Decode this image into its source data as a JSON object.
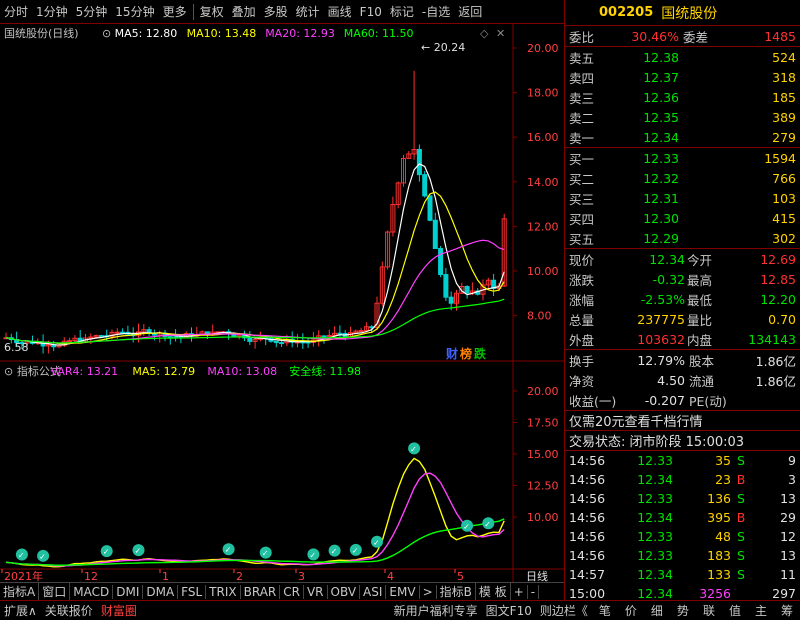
{
  "toolbar": {
    "items": [
      "分时",
      "1分钟",
      "5分钟",
      "15分钟",
      "更多",
      "复权",
      "叠加",
      "多股",
      "统计",
      "画线",
      "F10",
      "标记",
      "-自选",
      "返回"
    ]
  },
  "stock": {
    "code": "002205",
    "name": "国统股份"
  },
  "main_chart": {
    "title": "国统股份(日线)",
    "ma5": "MA5: 12.80",
    "ma10": "MA10: 13.48",
    "ma20": "MA20: 12.93",
    "ma60": "MA60: 11.50",
    "high_label": "20.24",
    "low_label": "6.58",
    "yticks": [
      "20.00",
      "18.00",
      "16.00",
      "14.00",
      "12.00",
      "10.00",
      "8.00"
    ],
    "badges": [
      "财",
      "榜",
      "跌"
    ]
  },
  "sub_chart": {
    "title": "指标公式",
    "var4": "VAR4: 13.21",
    "ma5": "MA5: 12.79",
    "ma10": "MA10: 13.08",
    "safe": "安全线: 11.98",
    "yticks": [
      "20.00",
      "17.50",
      "15.00",
      "12.50",
      "10.00"
    ]
  },
  "xaxis": {
    "labels": [
      "2021年",
      "12",
      "1",
      "2",
      "3",
      "4",
      "5"
    ],
    "period": "日线"
  },
  "tabs": [
    "指标A",
    "窗口",
    "MACD",
    "DMI",
    "DMA",
    "FSL",
    "TRIX",
    "BRAR",
    "CR",
    "VR",
    "OBV",
    "ASI",
    "EMV",
    ">",
    "指标B",
    "模 板",
    "+",
    "-"
  ],
  "bottom": {
    "items": [
      "扩展∧",
      "关联报价",
      "财富圈",
      "新用户福利专享",
      "图文F10",
      "则边栏《"
    ],
    "icons": [
      "笔",
      "价",
      "细",
      "势",
      "联",
      "值",
      "主",
      "筹"
    ]
  },
  "orderbook": {
    "wb_label": "委比",
    "wb": "30.46%",
    "wc_label": "委差",
    "wc": "1485",
    "asks": [
      {
        "l": "卖五",
        "p": "12.38",
        "v": "524"
      },
      {
        "l": "卖四",
        "p": "12.37",
        "v": "318"
      },
      {
        "l": "卖三",
        "p": "12.36",
        "v": "185"
      },
      {
        "l": "卖二",
        "p": "12.35",
        "v": "389"
      },
      {
        "l": "卖一",
        "p": "12.34",
        "v": "279"
      }
    ],
    "bids": [
      {
        "l": "买一",
        "p": "12.33",
        "v": "1594"
      },
      {
        "l": "买二",
        "p": "12.32",
        "v": "766"
      },
      {
        "l": "买三",
        "p": "12.31",
        "v": "103"
      },
      {
        "l": "买四",
        "p": "12.30",
        "v": "415"
      },
      {
        "l": "买五",
        "p": "12.29",
        "v": "302"
      }
    ]
  },
  "quote": [
    {
      "a": "现价",
      "av": "12.34",
      "ac": "g",
      "b": "今开",
      "bv": "12.69",
      "bc": "r"
    },
    {
      "a": "涨跌",
      "av": "-0.32",
      "ac": "g",
      "b": "最高",
      "bv": "12.85",
      "bc": "r"
    },
    {
      "a": "涨幅",
      "av": "-2.53%",
      "ac": "g",
      "b": "最低",
      "bv": "12.20",
      "bc": "g"
    },
    {
      "a": "总量",
      "av": "237775",
      "ac": "y",
      "b": "量比",
      "bv": "0.70",
      "bc": "y"
    },
    {
      "a": "外盘",
      "av": "103632",
      "ac": "r",
      "b": "内盘",
      "bv": "134143",
      "bc": "g"
    }
  ],
  "fin": [
    {
      "a": "换手",
      "av": "12.79%",
      "b": "股本",
      "bv": "1.86亿"
    },
    {
      "a": "净资",
      "av": "4.50",
      "b": "流通",
      "bv": "1.86亿"
    },
    {
      "a": "收益(一)",
      "av": "-0.207",
      "b": "PE(动)",
      "bv": ""
    }
  ],
  "promo": "仅需20元查看千档行情",
  "trade_status": "交易状态: 闭市阶段 15:00:03",
  "ticks": [
    {
      "t": "14:56",
      "p": "12.33",
      "v": "35",
      "s": "S",
      "n": "9",
      "vc": "y",
      "sc": "g"
    },
    {
      "t": "14:56",
      "p": "12.34",
      "v": "23",
      "s": "B",
      "n": "3",
      "vc": "y",
      "sc": "r"
    },
    {
      "t": "14:56",
      "p": "12.33",
      "v": "136",
      "s": "S",
      "n": "13",
      "vc": "y",
      "sc": "g"
    },
    {
      "t": "14:56",
      "p": "12.34",
      "v": "395",
      "s": "B",
      "n": "29",
      "vc": "y",
      "sc": "r"
    },
    {
      "t": "14:56",
      "p": "12.33",
      "v": "48",
      "s": "S",
      "n": "12",
      "vc": "y",
      "sc": "g"
    },
    {
      "t": "14:56",
      "p": "12.33",
      "v": "183",
      "s": "S",
      "n": "13",
      "vc": "y",
      "sc": "g"
    },
    {
      "t": "14:57",
      "p": "12.34",
      "v": "133",
      "s": "S",
      "n": "11",
      "vc": "y",
      "sc": "g"
    },
    {
      "t": "15:00",
      "p": "12.34",
      "v": "3256",
      "s": "",
      "n": "297",
      "vc": "m",
      "sc": "g"
    }
  ]
}
